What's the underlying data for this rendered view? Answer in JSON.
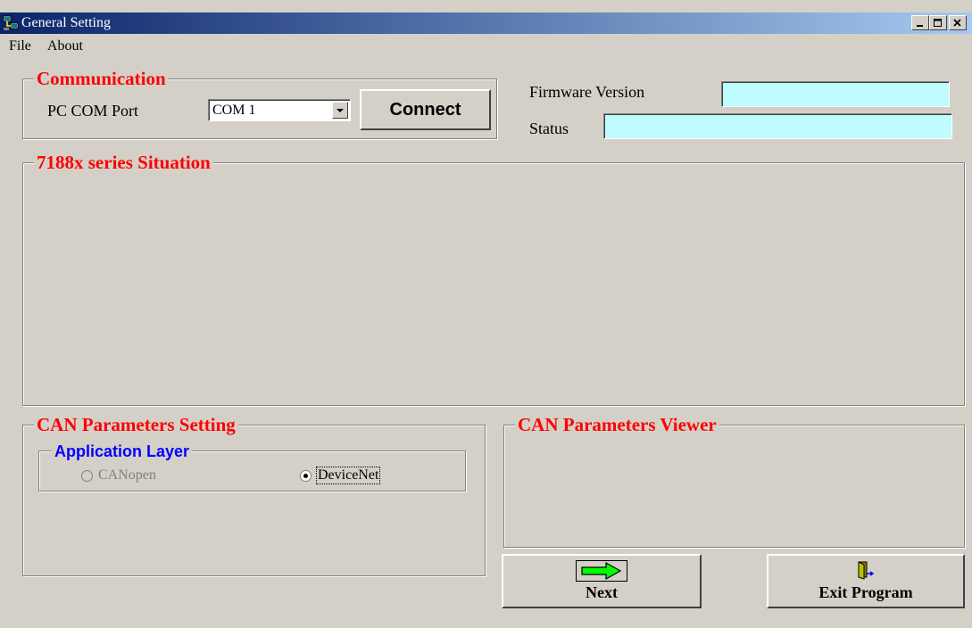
{
  "window": {
    "title": "General Setting"
  },
  "menu": {
    "items": [
      "File",
      "About"
    ]
  },
  "communication": {
    "legend": "Communication",
    "port_label": "PC COM Port",
    "port_value": "COM 1",
    "connect_label": "Connect"
  },
  "info": {
    "firmware_label": "Firmware Version",
    "firmware_value": "",
    "status_label": "Status",
    "status_value": ""
  },
  "situation": {
    "legend": "7188x series Situation"
  },
  "can_setting": {
    "legend": "CAN Parameters Setting",
    "app_layer_legend": "Application Layer",
    "options": [
      {
        "label": "CANopen",
        "selected": false,
        "enabled": false
      },
      {
        "label": "DeviceNet",
        "selected": true,
        "enabled": true
      }
    ]
  },
  "can_viewer": {
    "legend": "CAN Parameters Viewer"
  },
  "buttons": {
    "next_label": "Next",
    "exit_label": "Exit Program"
  },
  "colors": {
    "legend_red": "#ff0000",
    "legend_blue": "#0000ff",
    "field_bg": "#bffcff",
    "face": "#d4d0c8"
  }
}
